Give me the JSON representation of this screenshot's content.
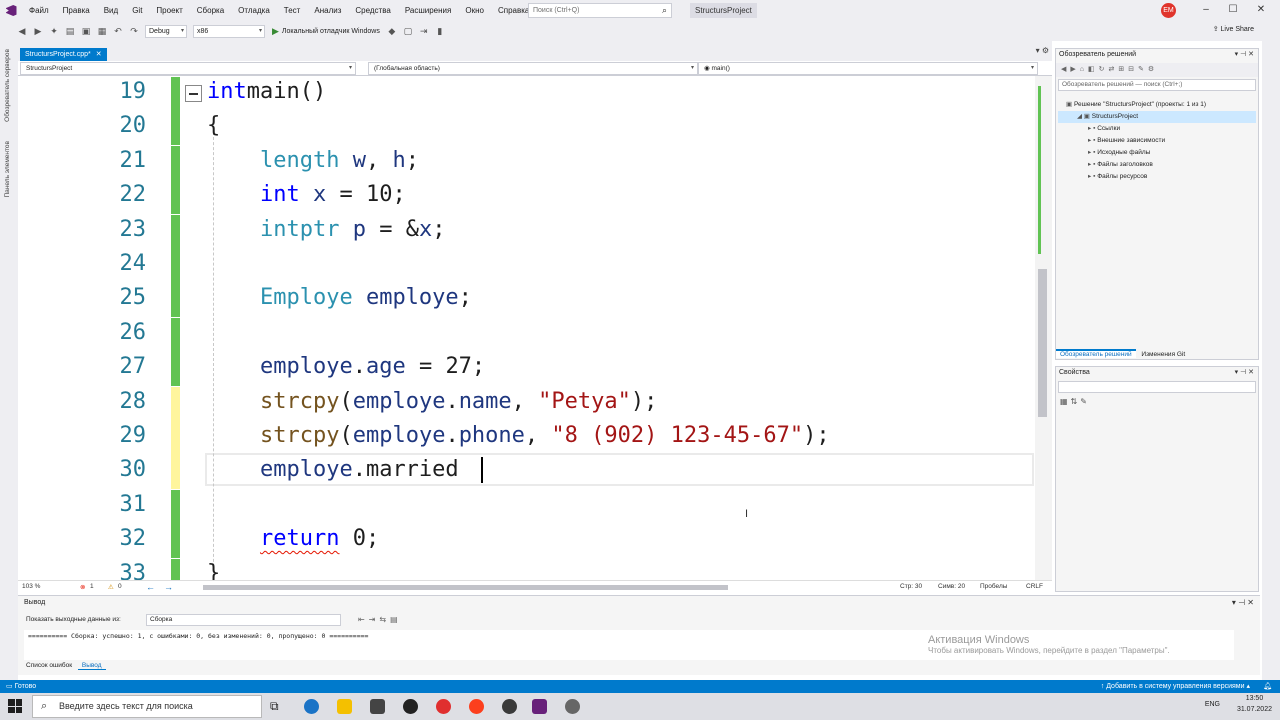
{
  "menu": {
    "items": [
      "Файл",
      "Правка",
      "Вид",
      "Git",
      "Проект",
      "Сборка",
      "Отладка",
      "Тест",
      "Анализ",
      "Средства",
      "Расширения",
      "Окно",
      "Справка"
    ],
    "search_placeholder": "Поиск (Ctrl+Q)",
    "solution_title": "StructursProject",
    "user_initials": "EM"
  },
  "toolbar": {
    "config": "Debug",
    "platform": "x86",
    "run_label": "Локальный отладчик Windows",
    "live_share": "Live Share"
  },
  "side_tabs": [
    "Обозреватель серверов",
    "Панель элементов"
  ],
  "document": {
    "tab_label": "StructursProject.cpp*",
    "nav_project": "StructursProject",
    "nav_scope": "(Глобальная область)",
    "nav_member": "main()"
  },
  "code": {
    "lines": [
      {
        "n": "19",
        "t": [
          [
            "kw",
            "int"
          ],
          [
            "",
            "main()"
          ]
        ]
      },
      {
        "n": "20",
        "t": [
          [
            "",
            "{"
          ]
        ]
      },
      {
        "n": "21",
        "t": [
          [
            "",
            "    "
          ],
          [
            "ty",
            "length"
          ],
          [
            "",
            ""
          ],
          [
            "vr",
            " w"
          ],
          [
            "",
            ","
          ],
          [
            "vr",
            " h"
          ],
          [
            "",
            ";"
          ]
        ]
      },
      {
        "n": "22",
        "t": [
          [
            "",
            "    "
          ],
          [
            "kw",
            "int"
          ],
          [
            "vr",
            " x"
          ],
          [
            "",
            " = 10;"
          ]
        ]
      },
      {
        "n": "23",
        "t": [
          [
            "",
            "    "
          ],
          [
            "ty",
            "intptr"
          ],
          [
            "vr",
            " p"
          ],
          [
            "",
            " = &"
          ],
          [
            "vr",
            "x"
          ],
          [
            "",
            ";"
          ]
        ]
      },
      {
        "n": "24",
        "t": []
      },
      {
        "n": "25",
        "t": [
          [
            "",
            "    "
          ],
          [
            "ty",
            "Employe"
          ],
          [
            "vr",
            " employe"
          ],
          [
            "",
            ";"
          ]
        ]
      },
      {
        "n": "26",
        "t": []
      },
      {
        "n": "27",
        "t": [
          [
            "",
            "    "
          ],
          [
            "vr",
            "employe"
          ],
          [
            "",
            "."
          ],
          [
            "vr",
            "age"
          ],
          [
            "",
            " = 27;"
          ]
        ]
      },
      {
        "n": "28",
        "t": [
          [
            "",
            "    "
          ],
          [
            "fn",
            "strcpy"
          ],
          [
            "",
            "("
          ],
          [
            "vr",
            "employe"
          ],
          [
            "",
            "."
          ],
          [
            "vr",
            "name"
          ],
          [
            "",
            ", "
          ],
          [
            "str",
            "\"Petya\""
          ],
          [
            "",
            ");"
          ]
        ]
      },
      {
        "n": "29",
        "t": [
          [
            "",
            "    "
          ],
          [
            "fn",
            "strcpy"
          ],
          [
            "",
            "("
          ],
          [
            "vr",
            "employe"
          ],
          [
            "",
            "."
          ],
          [
            "vr",
            "phone"
          ],
          [
            "",
            ", "
          ],
          [
            "str",
            "\"8 (902) 123-45-67\""
          ],
          [
            "",
            ");"
          ]
        ]
      },
      {
        "n": "30",
        "t": [
          [
            "",
            "    "
          ],
          [
            "vr",
            "employe"
          ],
          [
            "",
            ".married"
          ]
        ]
      },
      {
        "n": "31",
        "t": []
      },
      {
        "n": "32",
        "t": [
          [
            "",
            "    "
          ],
          [
            "kw sq",
            "return"
          ],
          [
            "",
            " 0;"
          ]
        ]
      },
      {
        "n": "33",
        "t": [
          [
            "",
            "}"
          ]
        ]
      }
    ],
    "change_markers": [
      "green",
      "green",
      "green",
      "green",
      "green",
      "green",
      "green",
      "green",
      "green",
      "yellow",
      "yellow",
      "yellow",
      "green",
      "green",
      "green"
    ]
  },
  "editor_footer": {
    "zoom": "103 %",
    "errors": "1",
    "warnings": "0",
    "line": "Стр: 30",
    "col": "Симв: 20",
    "spaces": "Пробелы",
    "eol": "CRLF"
  },
  "solution_explorer": {
    "title": "Обозреватель решений",
    "search_placeholder": "Обозреватель решений — поиск (Ctrl+;)",
    "tree": [
      {
        "label": "Решение \"StructursProject\" (проекты: 1 из 1)",
        "indent": 0,
        "selected": false
      },
      {
        "label": "StructursProject",
        "indent": 1,
        "selected": true
      },
      {
        "label": "Ссылки",
        "indent": 2,
        "selected": false
      },
      {
        "label": "Внешние зависимости",
        "indent": 2,
        "selected": false
      },
      {
        "label": "Исходные файлы",
        "indent": 2,
        "selected": false
      },
      {
        "label": "Файлы заголовков",
        "indent": 2,
        "selected": false
      },
      {
        "label": "Файлы ресурсов",
        "indent": 2,
        "selected": false
      }
    ],
    "tab_solution": "Обозреватель решений",
    "tab_git": "Изменения Git"
  },
  "properties": {
    "title": "Свойства"
  },
  "output": {
    "title": "Вывод",
    "show_label": "Показать выходные данные из:",
    "source": "Сборка",
    "text": "========== Сборка: успешно: 1, с ошибками: 0, без изменений: 0, пропущено: 0 ==========",
    "tab_errors": "Список ошибок",
    "tab_output": "Вывод"
  },
  "activation": {
    "title": "Активация Windows",
    "subtitle": "Чтобы активировать Windows, перейдите в раздел \"Параметры\"."
  },
  "statusbar": {
    "ready": "Готово",
    "scm": "Добавить в систему управления версиями"
  },
  "taskbar": {
    "search_placeholder": "Введите здесь текст для поиска",
    "lang": "ENG",
    "time": "13:50",
    "date": "31.07.2022"
  },
  "colors": {
    "accent": "#007acc",
    "keyword": "#0000ff",
    "type": "#2b91af",
    "function": "#74531f",
    "variable": "#1f377f",
    "string": "#a31515",
    "change_green": "#61c353",
    "change_yellow": "#fff59d"
  }
}
